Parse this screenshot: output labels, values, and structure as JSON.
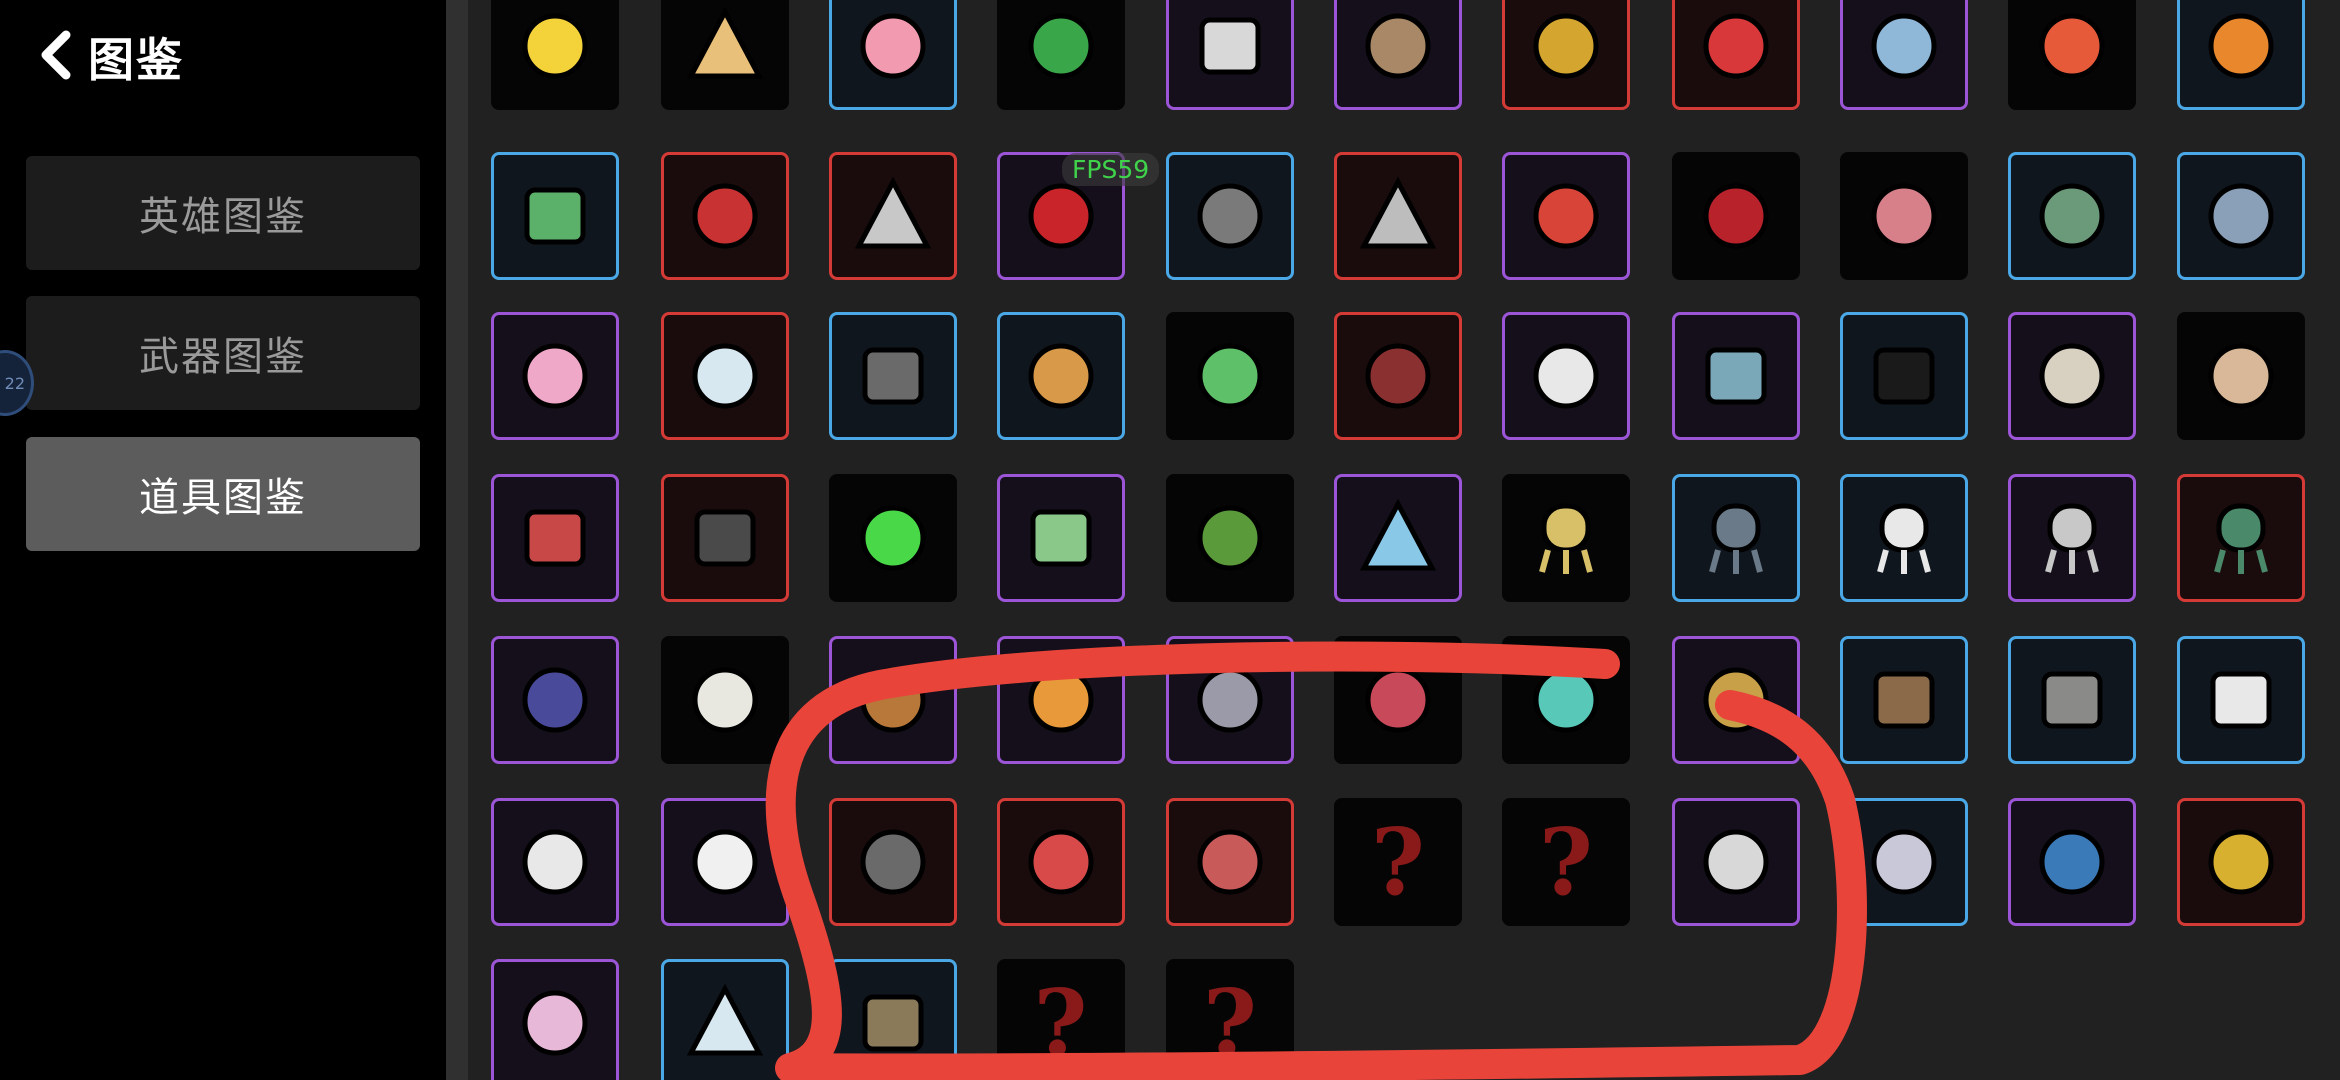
{
  "header": {
    "back_icon": "chevron-left-icon",
    "title": "图鉴"
  },
  "menu": [
    {
      "label": "英雄图鉴",
      "active": false
    },
    {
      "label": "武器图鉴",
      "active": false
    },
    {
      "label": "道具图鉴",
      "active": true
    }
  ],
  "edge_badge": {
    "text": "22"
  },
  "fps_overlay": "FPS59",
  "colors": {
    "rarity_blue": "#4aa8e6",
    "rarity_purple": "#9b55d6",
    "rarity_red": "#d43a36",
    "locked": "#050505",
    "annotation": "#e8443a"
  },
  "items": [
    [
      {
        "icon": "bee-icon",
        "rarity": "black"
      },
      {
        "icon": "pencil-icon",
        "rarity": "black"
      },
      {
        "icon": "piggy-bank-icon",
        "rarity": "blue"
      },
      {
        "icon": "sprout-icon",
        "rarity": "black"
      },
      {
        "icon": "bucket-icon",
        "rarity": "purple"
      },
      {
        "icon": "mortar-pestle-icon",
        "rarity": "purple"
      },
      {
        "icon": "potato-icon",
        "rarity": "red"
      },
      {
        "icon": "test-tube-icon",
        "rarity": "red"
      },
      {
        "icon": "robot-potion-icon",
        "rarity": "purple"
      },
      {
        "icon": "propeller-cap-icon",
        "rarity": "black"
      },
      {
        "icon": "pumpkin-icon",
        "rarity": "blue"
      }
    ],
    [
      {
        "icon": "sewing-machine-icon",
        "rarity": "blue"
      },
      {
        "icon": "red-hoodie-icon",
        "rarity": "red"
      },
      {
        "icon": "lightning-wand-icon",
        "rarity": "red"
      },
      {
        "icon": "claw-marks-icon",
        "rarity": "purple"
      },
      {
        "icon": "stone-circle-icon",
        "rarity": "blue"
      },
      {
        "icon": "staff-icon",
        "rarity": "red"
      },
      {
        "icon": "tomato-face-icon",
        "rarity": "purple"
      },
      {
        "icon": "red-cross-icon",
        "rarity": "black"
      },
      {
        "icon": "meat-bone-icon",
        "rarity": "black"
      },
      {
        "icon": "flashlight-icon",
        "rarity": "blue"
      },
      {
        "icon": "flask-icon",
        "rarity": "blue"
      }
    ],
    [
      {
        "icon": "pink-blob-icon",
        "rarity": "purple"
      },
      {
        "icon": "snowflake-orb-icon",
        "rarity": "red"
      },
      {
        "icon": "vent-icon",
        "rarity": "blue"
      },
      {
        "icon": "snail-icon",
        "rarity": "blue"
      },
      {
        "icon": "snake-icon",
        "rarity": "black"
      },
      {
        "icon": "spider-icon",
        "rarity": "red"
      },
      {
        "icon": "statue-icon",
        "rarity": "purple"
      },
      {
        "icon": "gift-box-icon",
        "rarity": "purple"
      },
      {
        "icon": "glasses-icon",
        "rarity": "blue"
      },
      {
        "icon": "tardigrade-icon",
        "rarity": "purple"
      },
      {
        "icon": "sack-face-icon",
        "rarity": "black"
      }
    ],
    [
      {
        "icon": "birdhouse-icon",
        "rarity": "purple"
      },
      {
        "icon": "broken-helmet-icon",
        "rarity": "red"
      },
      {
        "icon": "green-slime-icon",
        "rarity": "black"
      },
      {
        "icon": "tractor-icon",
        "rarity": "purple"
      },
      {
        "icon": "tree-icon",
        "rarity": "black"
      },
      {
        "icon": "triangle-prism-icon",
        "rarity": "purple"
      },
      {
        "icon": "gold-turret-icon",
        "rarity": "black"
      },
      {
        "icon": "gray-turret-icon",
        "rarity": "blue"
      },
      {
        "icon": "healing-turret-icon",
        "rarity": "blue"
      },
      {
        "icon": "target-turret-icon",
        "rarity": "purple"
      },
      {
        "icon": "green-turret-icon",
        "rarity": "red"
      }
    ],
    [
      {
        "icon": "scarecrow-icon",
        "rarity": "purple"
      },
      {
        "icon": "ghost-tooth-icon",
        "rarity": "black"
      },
      {
        "icon": "jug-icon",
        "rarity": "purple"
      },
      {
        "icon": "halo-ring-icon",
        "rarity": "purple"
      },
      {
        "icon": "chain-claw-icon",
        "rarity": "purple"
      },
      {
        "icon": "critter-icon",
        "rarity": "black"
      },
      {
        "icon": "biohazard-icon",
        "rarity": "black"
      },
      {
        "icon": "wheat-icon",
        "rarity": "purple"
      },
      {
        "icon": "wheelbarrow-icon",
        "rarity": "blue"
      },
      {
        "icon": "stone-slab-icon",
        "rarity": "blue"
      },
      {
        "icon": "white-flag-icon",
        "rarity": "blue"
      }
    ],
    [
      {
        "icon": "wings-icon",
        "rarity": "purple"
      },
      {
        "icon": "beard-icon",
        "rarity": "purple"
      },
      {
        "icon": "wolf-head-icon",
        "rarity": "red"
      },
      {
        "icon": "bloody-glove-icon",
        "rarity": "red"
      },
      {
        "icon": "stomach-icon",
        "rarity": "red"
      },
      {
        "icon": "question-mark-icon",
        "rarity": "black",
        "locked": true,
        "text": "?"
      },
      {
        "icon": "question-mark-icon",
        "rarity": "black",
        "locked": true,
        "text": "?"
      },
      {
        "icon": "bottle-icon",
        "rarity": "purple"
      },
      {
        "icon": "bone-key-icon",
        "rarity": "blue"
      },
      {
        "icon": "peacock-icon",
        "rarity": "purple"
      },
      {
        "icon": "gold-coin-icon",
        "rarity": "red"
      }
    ],
    [
      {
        "icon": "brain-icon",
        "rarity": "purple"
      },
      {
        "icon": "crystal-shard-icon",
        "rarity": "blue"
      },
      {
        "icon": "garden-plot-icon",
        "rarity": "blue"
      },
      {
        "icon": "question-mark-icon",
        "rarity": "black",
        "locked": true,
        "text": "?"
      },
      {
        "icon": "question-mark-icon",
        "rarity": "black",
        "locked": true,
        "text": "?"
      }
    ]
  ]
}
